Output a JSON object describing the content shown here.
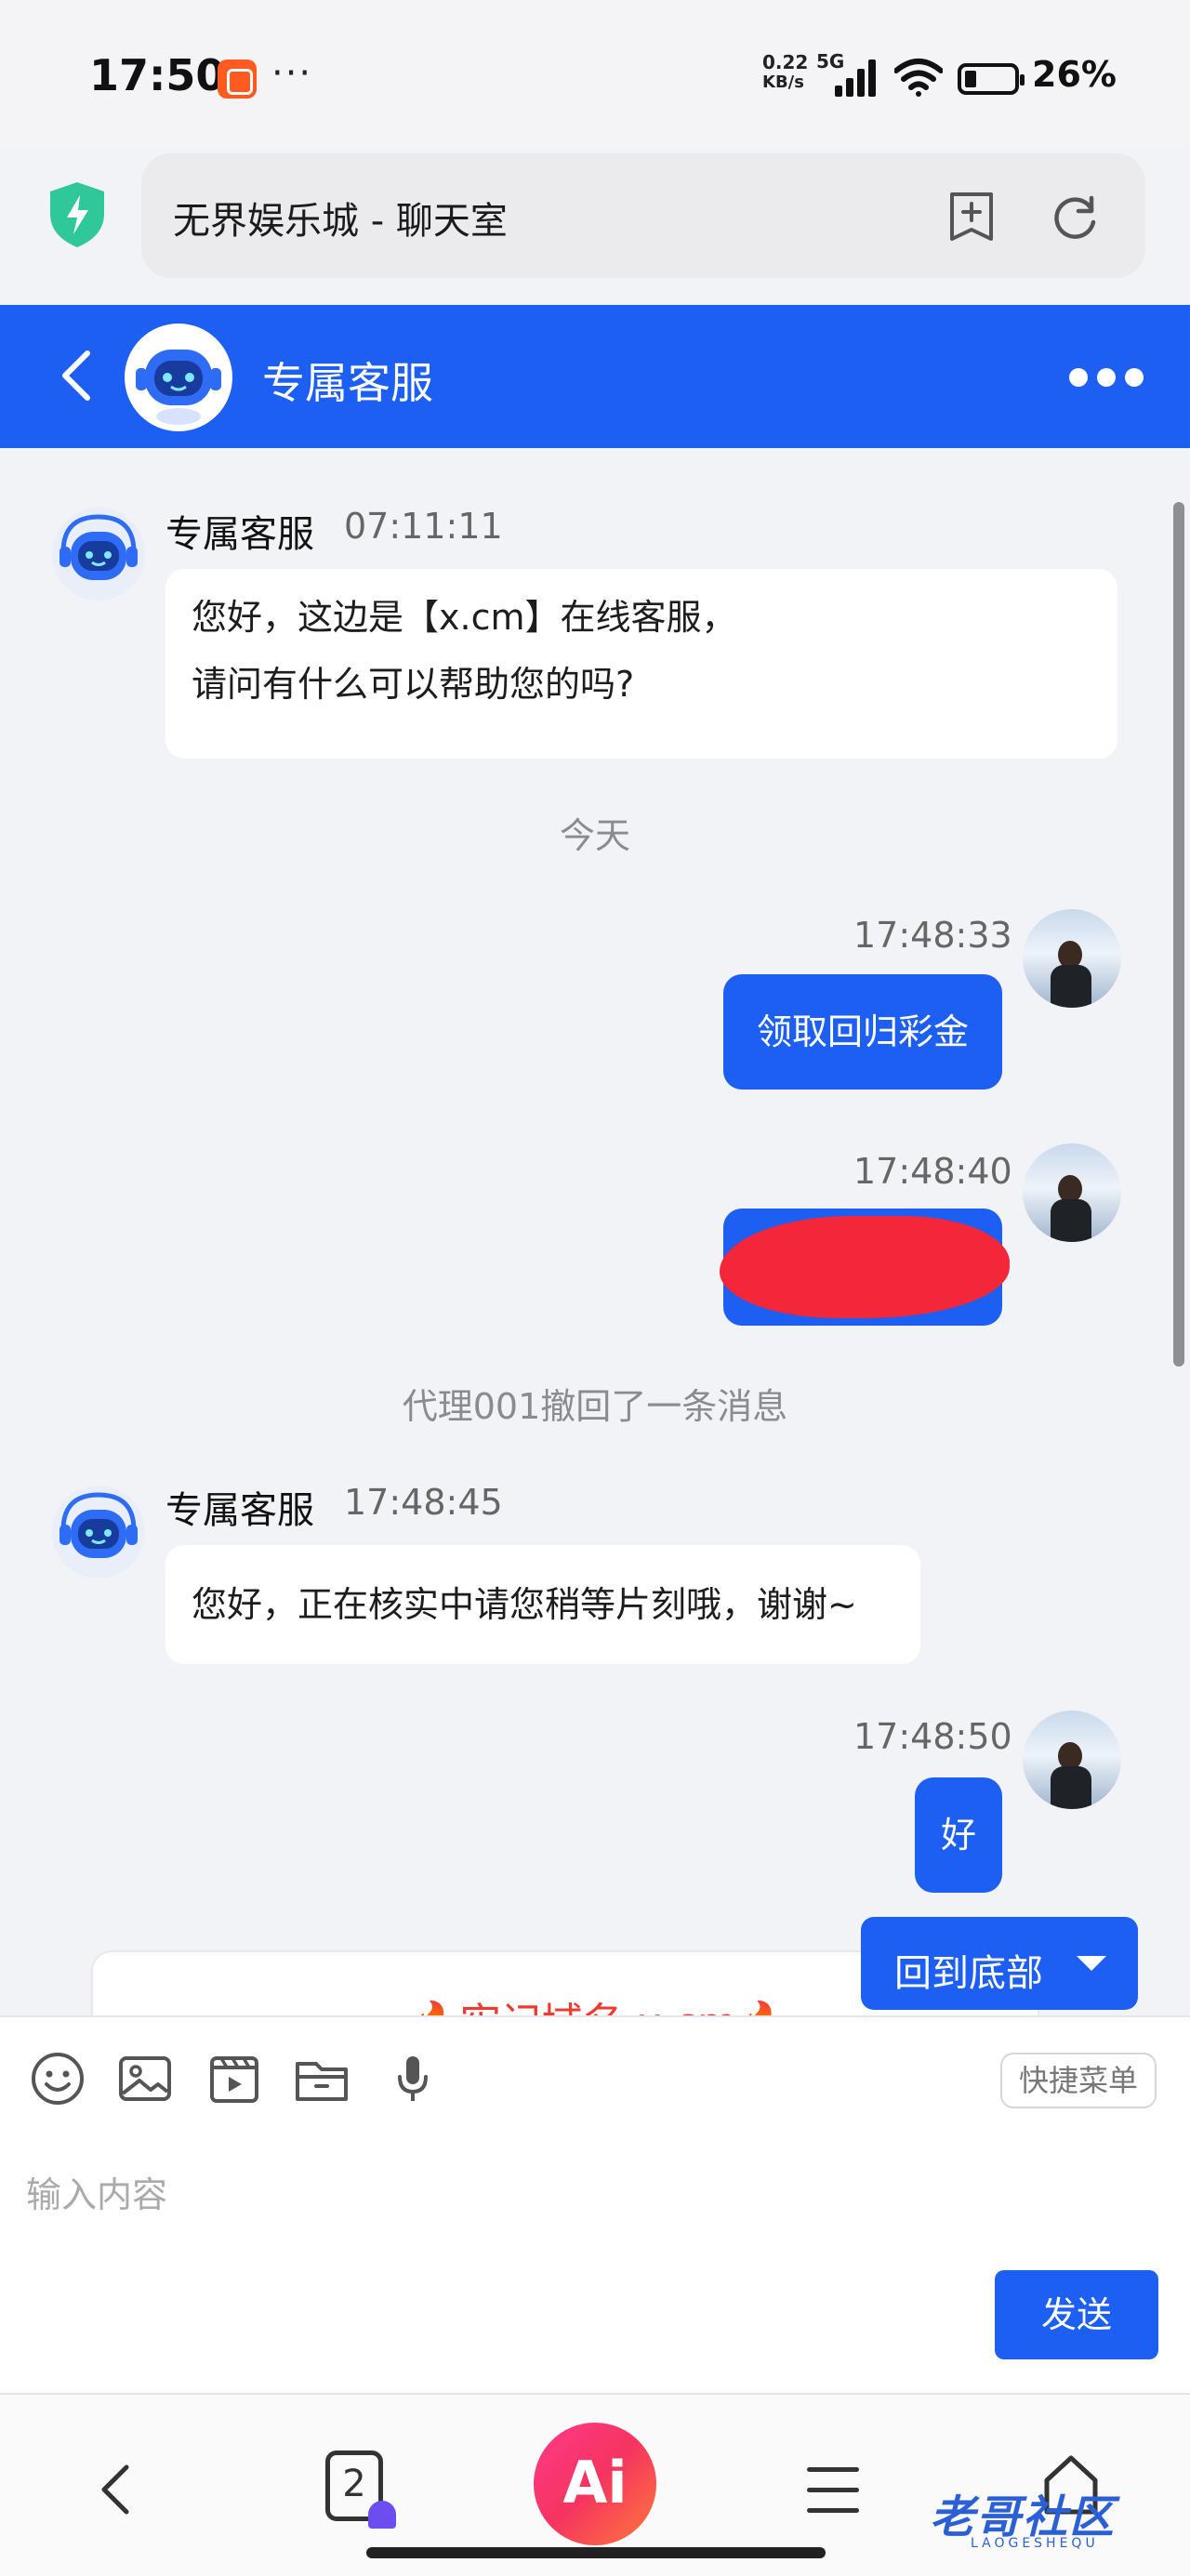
{
  "status_bar": {
    "time": "17:50",
    "more": "···",
    "net_speed_top": "0.22",
    "net_speed_unit": "KB/s",
    "network": "5G",
    "battery": "26%"
  },
  "browser": {
    "url_title": "无界娱乐城 - 聊天室",
    "icons": [
      "shield-icon",
      "add-bookmark-icon",
      "refresh-icon"
    ]
  },
  "header": {
    "title": "专属客服",
    "accent_color": "#1d5ff2"
  },
  "messages": {
    "m1": {
      "sender": "专属客服",
      "time": "07:11:11",
      "line1": "您好，这边是【x.cm】在线客服，",
      "line2": "请问有什么可以帮助您的吗?"
    },
    "divider_today": "今天",
    "m2": {
      "time": "17:48:33",
      "text": "领取回归彩金"
    },
    "m3": {
      "time": "17:48:40"
    },
    "recalled": "代理001撤回了一条消息",
    "m4": {
      "sender": "专属客服",
      "time": "17:48:45",
      "text": "您好，正在核实中请您稍等片刻哦，谢谢~"
    },
    "m5": {
      "time": "17:48:50",
      "text": "好"
    },
    "preview_card_text": "🔥牢记域名:x.cm🔥"
  },
  "scroll_to_bottom": {
    "label": "回到底部"
  },
  "composer": {
    "tools": [
      "emoji-icon",
      "image-icon",
      "video-icon",
      "folder-icon",
      "microphone-icon"
    ],
    "quick_menu": "快捷菜单",
    "placeholder": "输入内容",
    "send": "发送"
  },
  "bottom_nav": {
    "tab_count": "2",
    "ai_label": "Ai",
    "watermark": "老哥社区",
    "watermark_sub": "LAOGESHEQU"
  }
}
